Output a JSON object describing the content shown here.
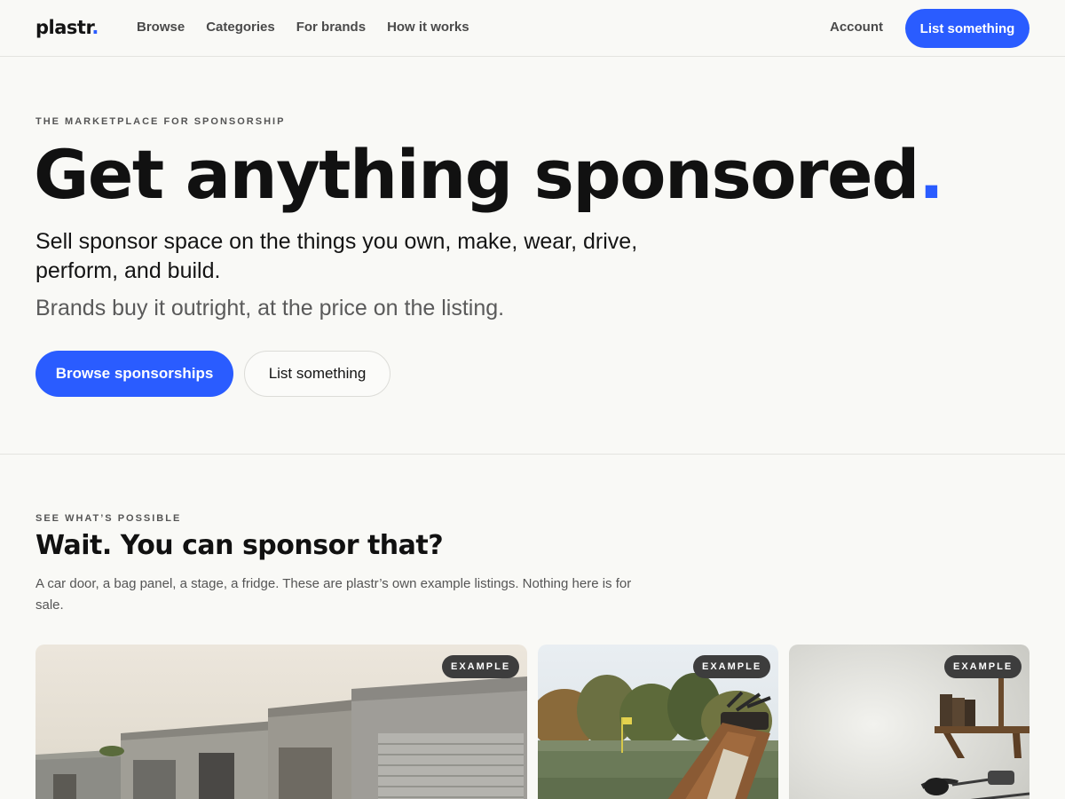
{
  "header": {
    "logo_text": "plastr",
    "logo_dot": ".",
    "nav": [
      "Browse",
      "Categories",
      "For brands",
      "How it works"
    ],
    "account": "Account",
    "cta": "List something"
  },
  "hero": {
    "eyebrow": "THE MARKETPLACE FOR SPONSORSHIP",
    "title": "Get anything sponsored",
    "title_dot": ".",
    "subtitle": "Sell sponsor space on the things you own, make, wear, drive, perform, and build.",
    "subtitle2": "Brands buy it outright, at the price on the listing.",
    "primary_button": "Browse sponsorships",
    "secondary_button": "List something"
  },
  "examples": {
    "eyebrow": "SEE WHAT’S POSSIBLE",
    "title": "Wait. You can sponsor that?",
    "description": "A car door, a bag panel, a stage, a fridge. These are plastr’s own example listings. Nothing here is for sale.",
    "cards": [
      {
        "badge": "EXAMPLE",
        "image": "storage-garages-photo"
      },
      {
        "badge": "EXAMPLE",
        "image": "golf-bag-photo"
      },
      {
        "badge": "EXAMPLE",
        "image": "podcast-studio-photo"
      }
    ]
  },
  "colors": {
    "accent": "#2a5cff",
    "background": "#f9f9f6",
    "text": "#111111",
    "badge": "#3d3d3d"
  }
}
